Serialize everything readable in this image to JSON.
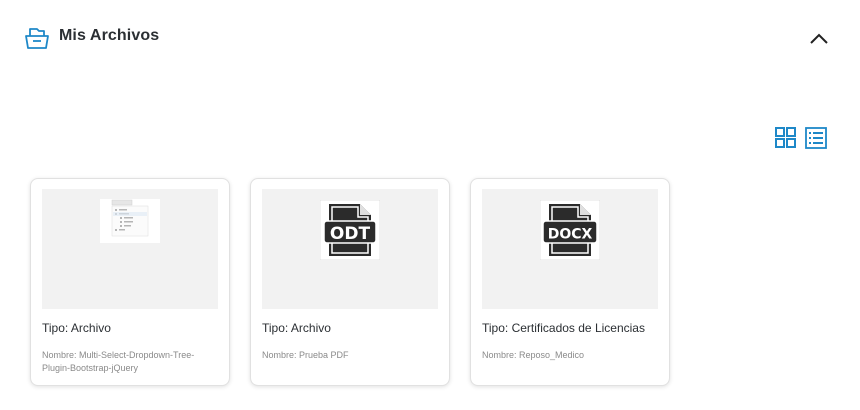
{
  "header": {
    "title": "Mis Archivos",
    "icon": "folder-icon",
    "collapse_icon": "chevron-up-icon"
  },
  "view_toggle": {
    "grid_icon": "grid-view-icon",
    "list_icon": "list-view-icon",
    "accent": "#1e88c8"
  },
  "cards": [
    {
      "thumbnail": "tree-dropdown-screenshot",
      "type": "Tipo: Archivo",
      "name": "Nombre: Multi-Select-Dropdown-Tree-Plugin-Bootstrap-jQuery"
    },
    {
      "thumbnail": "odt-file-icon",
      "thumbnail_label": "ODT",
      "type": "Tipo: Archivo",
      "name": "Nombre: Prueba PDF"
    },
    {
      "thumbnail": "docx-file-icon",
      "thumbnail_label": "DOCX",
      "type": "Tipo: Certificados de Licencias",
      "name": "Nombre: Reposo_Medico"
    }
  ]
}
